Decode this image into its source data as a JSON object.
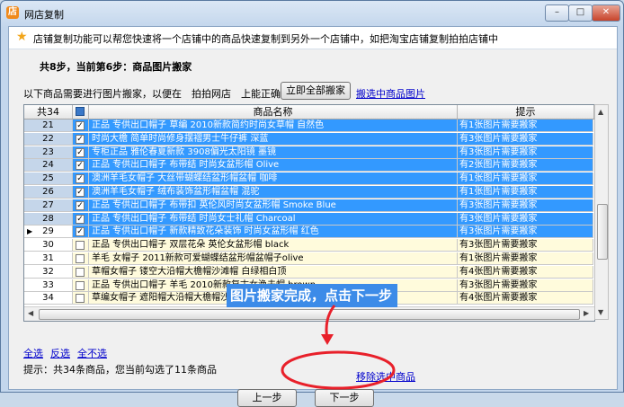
{
  "window": {
    "title": "网店复制",
    "app_icon": "店",
    "min_glyph": "–",
    "max_glyph": "□",
    "close_glyph": "✕"
  },
  "banner": {
    "icon": "star-icon",
    "text": "店铺复制功能可以帮您快速将一个店铺中的商品快速复制到另外一个店铺中，如把淘宝店铺复制拍拍店铺中"
  },
  "step": {
    "title": "共8步，当前第6步：商品图片搬家"
  },
  "hint": {
    "text": "以下商品需要进行图片搬家，以便在　拍拍网店　上能正确显示",
    "move_all_label": "立即全部搬家",
    "move_selected_label": "搬选中商品图片"
  },
  "table": {
    "columns": {
      "count": "共34",
      "name": "商品名称",
      "tip": "提示"
    },
    "rows": [
      {
        "num": "21",
        "checked": true,
        "name": "正品 专供出口帽子 草编 2010新款简约时尚女草帽 自然色",
        "tip": "有1张图片需要搬家",
        "state": "sel"
      },
      {
        "num": "22",
        "checked": true,
        "name": "时尚大檐 简单时尚修身摆褶男士牛仔裤 深蓝",
        "tip": "有3张图片需要搬家",
        "state": "sel"
      },
      {
        "num": "23",
        "checked": true,
        "name": "专柜正品 雅伦春夏新款 3908偏光太阳镜 墨镜",
        "tip": "有3张图片需要搬家",
        "state": "sel"
      },
      {
        "num": "24",
        "checked": true,
        "name": "正品 专供出口帽子 布带结 时尚女盆形帽 Olive",
        "tip": "有2张图片需要搬家",
        "state": "sel"
      },
      {
        "num": "25",
        "checked": true,
        "name": "澳洲羊毛女帽子 大丝带蝴蝶结盆形帽盆帽 咖啡",
        "tip": "有1张图片需要搬家",
        "state": "sel"
      },
      {
        "num": "26",
        "checked": true,
        "name": "澳洲羊毛女帽子 绒布装饰盆形帽盆帽 混驼",
        "tip": "有1张图片需要搬家",
        "state": "sel"
      },
      {
        "num": "27",
        "checked": true,
        "name": "正品 专供出口帽子 布带扣 英伦风时尚女盆形帽 Smoke Blue",
        "tip": "有3张图片需要搬家",
        "state": "sel"
      },
      {
        "num": "28",
        "checked": true,
        "name": "正品 专供出口帽子 布带结 时尚女士礼帽 Charcoal",
        "tip": "有3张图片需要搬家",
        "state": "sel"
      },
      {
        "num": "29",
        "checked": true,
        "name": "正品 专供出口帽子 新款精致花朵装饰 时尚女盆形帽 红色",
        "tip": "有3张图片需要搬家",
        "state": "sel",
        "current": true
      },
      {
        "num": "30",
        "checked": false,
        "name": "正品 专供出口帽子 双层花朵 英伦女盆形帽 black",
        "tip": "有3张图片需要搬家",
        "state": "unsel"
      },
      {
        "num": "31",
        "checked": false,
        "name": "羊毛 女帽子 2011新款可爱蝴蝶结盆形帽盆帽子olive",
        "tip": "有1张图片需要搬家",
        "state": "unsel"
      },
      {
        "num": "32",
        "checked": false,
        "name": "草帽女帽子 镂空大沿帽大檐帽沙滩帽 白绿相白顶",
        "tip": "有4张图片需要搬家",
        "state": "unsel"
      },
      {
        "num": "33",
        "checked": false,
        "name": "正品 专供出口帽子 羊毛 2010新款复古女渔夫帽 brown",
        "tip": "有3张图片需要搬家",
        "state": "unsel"
      },
      {
        "num": "34",
        "checked": false,
        "name": "草编女帽子 遮阳帽大沿帽大檐帽沙滩帽子",
        "tip": "有4张图片需要搬家",
        "state": "unsel"
      }
    ]
  },
  "selection": {
    "select_all": "全选",
    "invert": "反选",
    "select_none": "全不选",
    "summary": "提示：共34条商品，您当前勾选了11条商品",
    "move_selected_label": "移除选中商品"
  },
  "nav": {
    "prev_label": "上一步",
    "next_label": "下一步"
  },
  "annotation": {
    "text": "图片搬家完成，点击下一步",
    "color": "#e8202a"
  },
  "colors": {
    "selected_row": "#3399ff",
    "unselected_row": "#fffbdc",
    "link": "#0000cc"
  }
}
